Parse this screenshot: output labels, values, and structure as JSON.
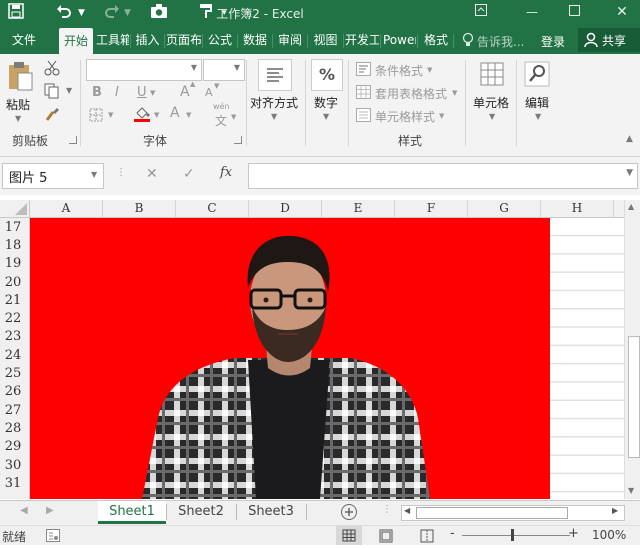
{
  "titlebar": {
    "title": "工作簿2 - Excel"
  },
  "tabs": [
    {
      "label": "文件"
    },
    {
      "label": "开始"
    },
    {
      "label": "工具箱"
    },
    {
      "label": "插入"
    },
    {
      "label": "页面布局"
    },
    {
      "label": "公式"
    },
    {
      "label": "数据"
    },
    {
      "label": "审阅"
    },
    {
      "label": "视图"
    },
    {
      "label": "开发工具"
    },
    {
      "label": "Power Pivot"
    },
    {
      "label": "格式"
    }
  ],
  "tell_me": "告诉我...",
  "login": "登录",
  "share": "共享",
  "ribbon": {
    "paste": "粘贴",
    "clipboard": "剪贴板",
    "font_group": "字体",
    "align": "对齐方式",
    "number": "数字",
    "percent_symbol": "%",
    "cond_format": "条件格式",
    "table_format": "套用表格格式",
    "cell_style": "单元格样式",
    "styles": "样式",
    "cells": "单元格",
    "editing": "编辑",
    "bold": "B",
    "italic": "I",
    "underline": "U",
    "font_up": "A",
    "font_down": "A",
    "font_color_letter": "A",
    "wen": "wén",
    "wen_char": "文"
  },
  "formula_bar": {
    "name_box": "图片 5",
    "fx": "fx",
    "cancel": "✕",
    "enter": "✓"
  },
  "grid": {
    "columns": [
      "A",
      "B",
      "C",
      "D",
      "E",
      "F",
      "G",
      "H"
    ],
    "rows": [
      "17",
      "18",
      "19",
      "20",
      "21",
      "22",
      "23",
      "24",
      "25",
      "26",
      "27",
      "28",
      "29",
      "30",
      "31"
    ]
  },
  "sheets": [
    {
      "label": "Sheet1",
      "active": true
    },
    {
      "label": "Sheet2",
      "active": false
    },
    {
      "label": "Sheet3",
      "active": false
    }
  ],
  "status": {
    "ready": "就绪",
    "zoom": "100%",
    "zoom_minus": "-",
    "zoom_plus": "+"
  },
  "colors": {
    "brand": "#217346",
    "picture_bg": "#ff0000"
  },
  "picture": {
    "subject": "bearded man with glasses wearing plaid flannel shirt over black t-shirt"
  }
}
